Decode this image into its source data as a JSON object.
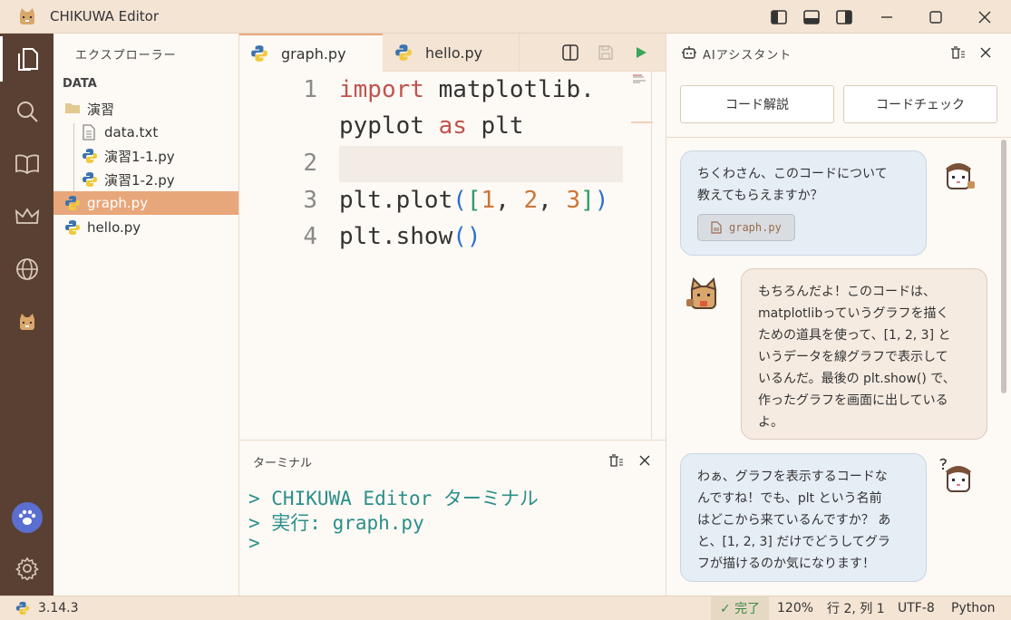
{
  "app": {
    "title": "CHIKUWA Editor"
  },
  "explorer": {
    "header": "エクスプローラー",
    "section": "DATA",
    "items": [
      {
        "label": "演習",
        "type": "folder"
      },
      {
        "label": "data.txt",
        "type": "text"
      },
      {
        "label": "演習1-1.py",
        "type": "python"
      },
      {
        "label": "演習1-2.py",
        "type": "python"
      },
      {
        "label": "graph.py",
        "type": "python",
        "selected": true
      },
      {
        "label": "hello.py",
        "type": "python"
      }
    ]
  },
  "tabs": [
    {
      "label": "graph.py",
      "active": true
    },
    {
      "label": "hello.py",
      "active": false
    }
  ],
  "editor": {
    "line_numbers": [
      "1",
      "2",
      "3",
      "4"
    ],
    "line1a": {
      "kw": "import",
      "rest": " matplotlib."
    },
    "line1b": {
      "a": "pyplot ",
      "kw": "as",
      "b": " plt"
    },
    "line3": {
      "a": "plt.plot",
      "p1": "(",
      "p2": "[",
      "n1": "1",
      "s1": ", ",
      "n2": "2",
      "s2": ", ",
      "n3": "3",
      "p3": "]",
      "p4": ")"
    },
    "line4": {
      "a": "plt.show",
      "p1": "(",
      "p2": ")"
    }
  },
  "terminal": {
    "header": "ターミナル",
    "lines": [
      "> CHIKUWA Editor ターミナル",
      "> 実行: graph.py",
      ">"
    ]
  },
  "ai": {
    "header": "AIアシスタント",
    "buttons": [
      "コード解説",
      "コードチェック"
    ],
    "messages": [
      {
        "role": "user",
        "lines": [
          "ちくわさん、このコードについて",
          "教えてもらえますか？"
        ],
        "attachment": "graph.py"
      },
      {
        "role": "assistant",
        "lines": [
          "もちろんだよ！このコードは、",
          "matplotlibっていうグラフを描く",
          "ための道具を使って、[1, 2, 3] と",
          "いうデータを線グラフで表示して",
          "いるんだ。最後の plt.show() で、",
          "作ったグラフを画面に出している",
          "よ。"
        ]
      },
      {
        "role": "user",
        "lines": [
          "わぁ、グラフを表示するコードな",
          "んですね！でも、plt という名前",
          "はどこから来ているんですか？ あ",
          "と、[1, 2, 3] だけでどうしてグラ",
          "フが描けるのか気になります！"
        ]
      }
    ]
  },
  "status": {
    "python_version": "3.14.3",
    "done": "✓ 完了",
    "zoom": "120%",
    "cursor": "行 2, 列 1",
    "encoding": "UTF-8",
    "language": "Python"
  },
  "colors": {
    "activity_bar": "#5a4032",
    "accent": "#e8a77a",
    "paw_button": "#5b6fd0"
  }
}
